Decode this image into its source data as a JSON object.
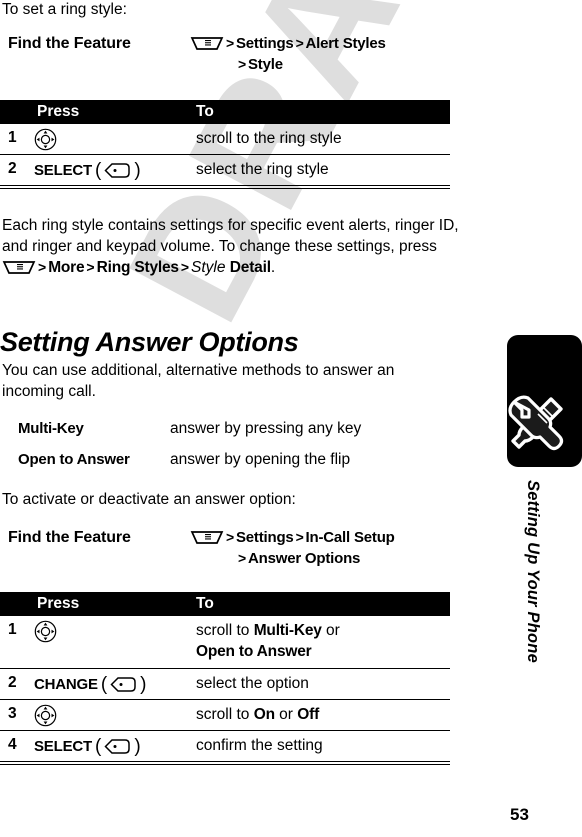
{
  "document": {
    "watermark": "DRAFT",
    "page_number": "53",
    "chapter_label": "Setting Up Your Phone"
  },
  "icons": {
    "menu_key": "menu-key-icon",
    "nav_key": "navigation-key-icon",
    "soft_key": "soft-key-icon",
    "chapter_tab": "wrench-screwdriver-icon"
  },
  "intro": {
    "ring_style_lead": "To set a ring style:",
    "activate_lead": "To activate or deactivate an answer option:"
  },
  "find_feature_1": {
    "label": "Find the Feature",
    "line1_a": "Settings",
    "line1_b": "Alert Styles",
    "line2": "Style",
    "separator": ">"
  },
  "table_1": {
    "header": {
      "press": "Press",
      "to": "To"
    },
    "rows": [
      {
        "num": "1",
        "press_key": "nav",
        "press_label": "",
        "to": "scroll to the ring style"
      },
      {
        "num": "2",
        "press_key": "soft",
        "press_label": "SELECT",
        "to": "select the ring style"
      }
    ]
  },
  "paragraph_1": {
    "text_a": "Each ring style contains settings for specific event alerts, ringer ID, and ringer and keypad volume. To change these settings, press ",
    "menu_path_1": "More",
    "menu_path_2": "Ring Styles",
    "menu_path_3": "Style",
    "menu_path_4": "Detail",
    "text_end": "."
  },
  "section": {
    "heading": "Setting Answer Options",
    "paragraph": "You can use additional, alternative methods to answer an incoming call."
  },
  "definitions": [
    {
      "term": "Multi-Key",
      "desc": "answer by pressing any key"
    },
    {
      "term": "Open to Answer",
      "desc": "answer by opening the flip"
    }
  ],
  "find_feature_2": {
    "label": "Find the Feature",
    "line1_a": "Settings",
    "line1_b": "In-Call Setup",
    "line2": "Answer Options",
    "separator": ">"
  },
  "table_2": {
    "header": {
      "press": "Press",
      "to": "To"
    },
    "rows": [
      {
        "num": "1",
        "press_key": "nav",
        "press_label": "",
        "to_pre": "scroll to ",
        "to_b1": "Multi-Key",
        "to_mid": " or",
        "to_b2": "Open to Answer"
      },
      {
        "num": "2",
        "press_key": "soft",
        "press_label": "CHANGE",
        "to": "select the option"
      },
      {
        "num": "3",
        "press_key": "nav",
        "press_label": "",
        "to_pre": "scroll to ",
        "to_b1": "On",
        "to_mid": " or ",
        "to_b2": "Off"
      },
      {
        "num": "4",
        "press_key": "soft",
        "press_label": "SELECT",
        "to": "confirm the setting"
      }
    ]
  }
}
